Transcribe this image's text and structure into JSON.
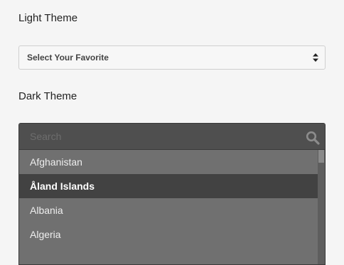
{
  "light_theme": {
    "label": "Light Theme",
    "select": {
      "selected": "Select Your Favorite",
      "icon": "up-down-arrows-icon"
    }
  },
  "dark_theme": {
    "label": "Dark Theme",
    "search": {
      "placeholder": "Search",
      "value": "",
      "icon": "search-icon"
    },
    "options": [
      {
        "label": "Afghanistan",
        "active": false
      },
      {
        "label": "Åland Islands",
        "active": true
      },
      {
        "label": "Albania",
        "active": false
      },
      {
        "label": "Algeria",
        "active": false
      }
    ]
  },
  "colors": {
    "page_bg": "#f5f5f5",
    "dark_list_bg": "#707070",
    "dark_search_bg": "#4f4f4f",
    "active_option_bg": "#424242"
  }
}
